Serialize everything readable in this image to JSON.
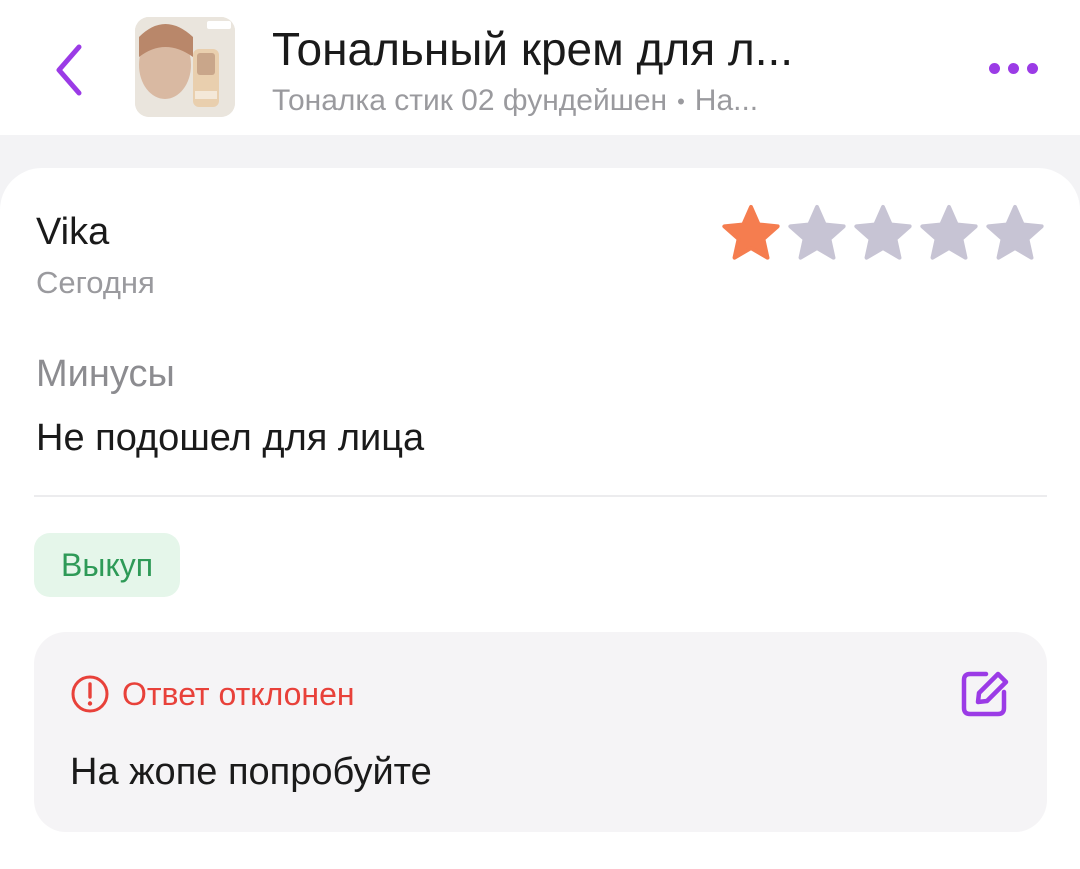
{
  "header": {
    "back_icon": "chevron-left-icon",
    "title": "Тональный крем для л...",
    "subtitle_variant": "Тоналка стик 02 фундейшен",
    "subtitle_separator": "•",
    "subtitle_tail": "На...",
    "more_icon": "more-dots-icon",
    "accent_color": "#9b3be6"
  },
  "review": {
    "author": "Vika",
    "date": "Сегодня",
    "rating": 1,
    "rating_max": 5,
    "star_filled_color": "#f57d4f",
    "star_empty_color": "#c7c4d4",
    "cons_label": "Минусы",
    "cons_text": "Не подошел для лица",
    "badge": "Выкуп",
    "badge_color": "#2e9a57"
  },
  "reply": {
    "status_icon": "alert-circle-icon",
    "status": "Ответ отклонен",
    "status_color": "#e8413a",
    "text": "На жопе попробуйте",
    "edit_icon": "edit-icon"
  }
}
